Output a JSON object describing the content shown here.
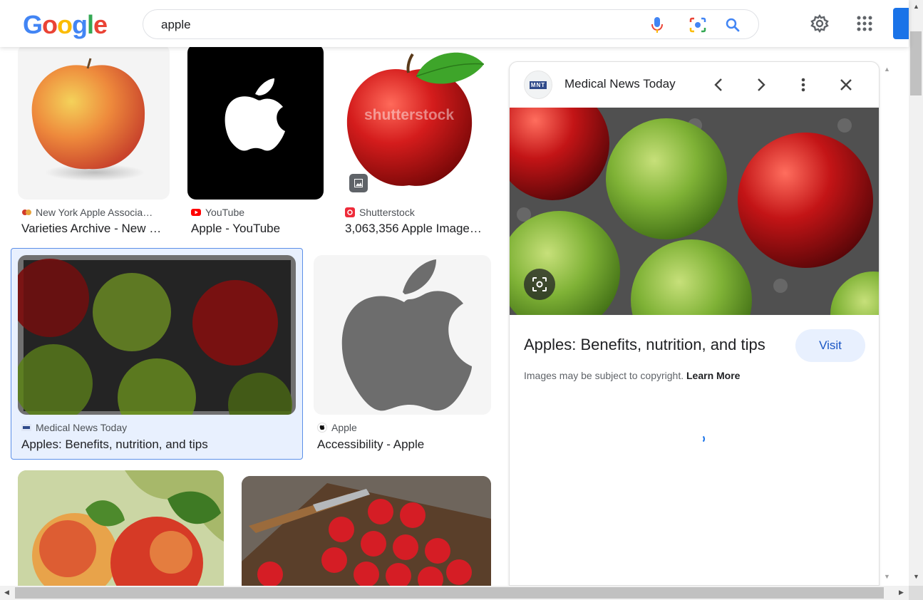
{
  "header": {
    "logo_letters": [
      "G",
      "o",
      "o",
      "g",
      "l",
      "e"
    ],
    "search_value": "apple",
    "icons": [
      "microphone-icon",
      "camera-lens-icon",
      "search-icon",
      "gear-icon",
      "apps-grid-icon"
    ]
  },
  "results": [
    {
      "source": "New York Apple Associa…",
      "title": "Varieties Archive - New …",
      "favicon": "apple-association-favicon"
    },
    {
      "source": "YouTube",
      "title": "Apple - YouTube",
      "favicon": "youtube-favicon"
    },
    {
      "source": "Shutterstock",
      "title": "3,063,356 Apple Image…",
      "favicon": "shutterstock-favicon",
      "watermark": "shutterstock"
    },
    {
      "source": "Medical News Today",
      "title": "Apples: Benefits, nutrition, and tips",
      "favicon": "mnt-favicon"
    },
    {
      "source": "Apple",
      "title": "Accessibility - Apple",
      "favicon": "apple-favicon"
    }
  ],
  "panel": {
    "source": "Medical News Today",
    "logo_text": "MNT",
    "title": "Apples: Benefits, nutrition, and tips",
    "visit_label": "Visit",
    "copyright_text": "Images may be subject to copyright.",
    "learn_more": "Learn More"
  },
  "colors": {
    "google_blue": "#4285f4",
    "google_red": "#ea4335",
    "google_yellow": "#fbbc05",
    "google_green": "#34a853",
    "selection_bg": "#e8f0fe",
    "visit_text": "#1a56c4"
  }
}
